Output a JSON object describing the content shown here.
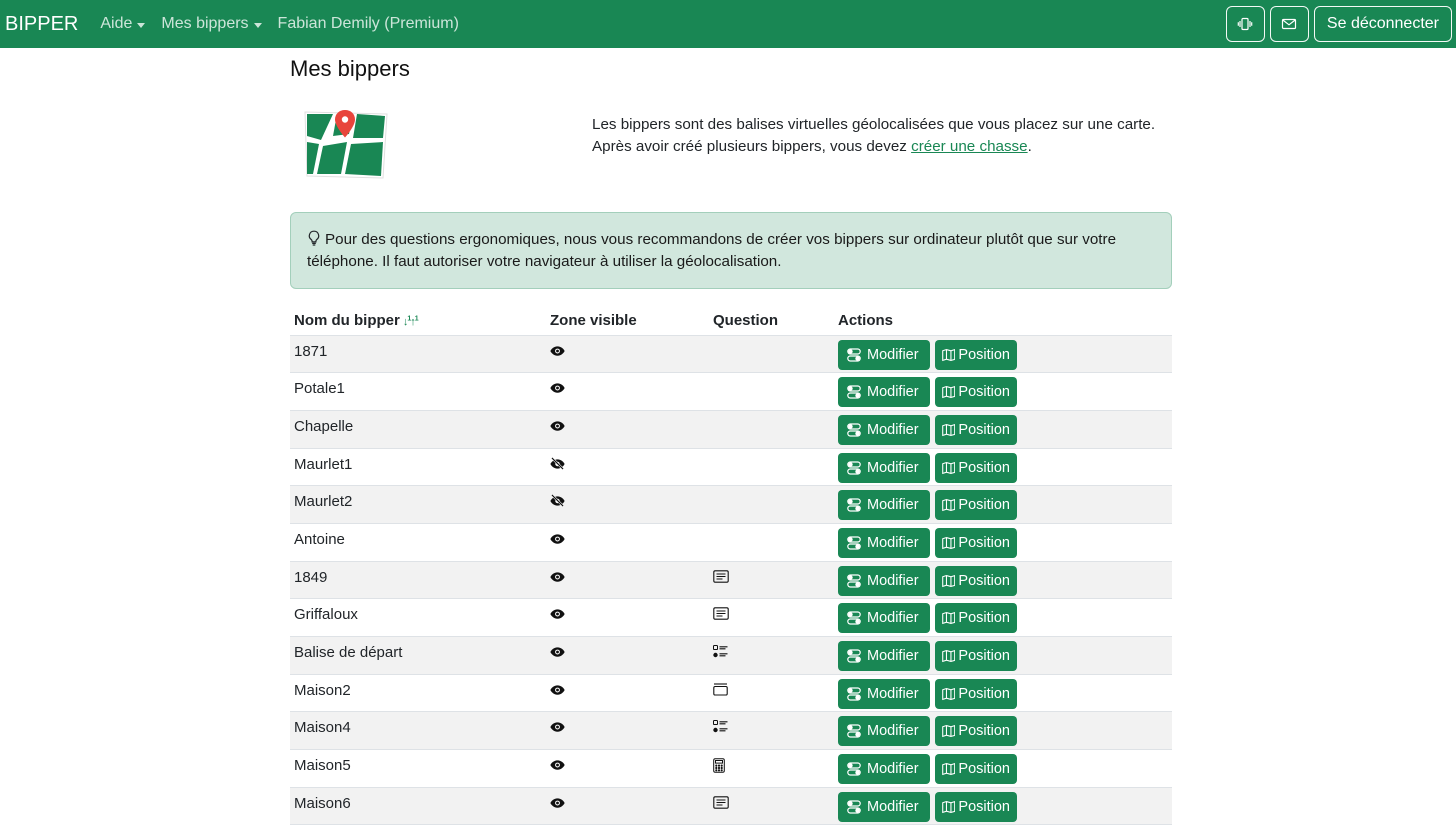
{
  "navbar": {
    "brand": "BIPPER",
    "links": [
      {
        "label": "Aide",
        "dropdown": true
      },
      {
        "label": "Mes bippers",
        "dropdown": true
      },
      {
        "label": "Fabian Demily (Premium)",
        "dropdown": false
      }
    ],
    "buttons": {
      "vibrate_icon": "vibrate-icon",
      "mail_icon": "envelope-icon",
      "logout_label": "Se déconnecter"
    }
  },
  "page": {
    "title": "Mes bippers",
    "intro_line1": "Les bippers sont des balises virtuelles géolocalisées que vous placez sur une carte.",
    "intro_line2_before": "Après avoir créé plusieurs bippers, vous devez ",
    "intro_link": "créer une chasse",
    "intro_line2_after": ".",
    "alert_text": "Pour des questions ergonomiques, nous vous recommandons de créer vos bippers sur ordinateur plutôt que sur votre téléphone. Il faut autoriser votre navigateur à utiliser la géolocalisation."
  },
  "table": {
    "headers": {
      "name": "Nom du bipper",
      "zone": "Zone visible",
      "question": "Question",
      "actions": "Actions"
    },
    "modify_label": "Modifier",
    "position_label": "Position",
    "rows": [
      {
        "name": "1871",
        "zone": "visible",
        "question": ""
      },
      {
        "name": "Potale1",
        "zone": "visible",
        "question": ""
      },
      {
        "name": "Chapelle",
        "zone": "visible",
        "question": ""
      },
      {
        "name": "Maurlet1",
        "zone": "hidden",
        "question": ""
      },
      {
        "name": "Maurlet2",
        "zone": "hidden",
        "question": ""
      },
      {
        "name": "Antoine",
        "zone": "visible",
        "question": ""
      },
      {
        "name": "1849",
        "zone": "visible",
        "question": "text"
      },
      {
        "name": "Griffaloux",
        "zone": "visible",
        "question": "text"
      },
      {
        "name": "Balise de départ",
        "zone": "visible",
        "question": "list"
      },
      {
        "name": "Maison2",
        "zone": "visible",
        "question": "card"
      },
      {
        "name": "Maison4",
        "zone": "visible",
        "question": "list"
      },
      {
        "name": "Maison5",
        "zone": "visible",
        "question": "calculator"
      },
      {
        "name": "Maison6",
        "zone": "visible",
        "question": "text"
      }
    ]
  },
  "colors": {
    "primary": "#198754",
    "alert_bg": "#d1e7dd",
    "stripe": "#f2f2f2"
  }
}
